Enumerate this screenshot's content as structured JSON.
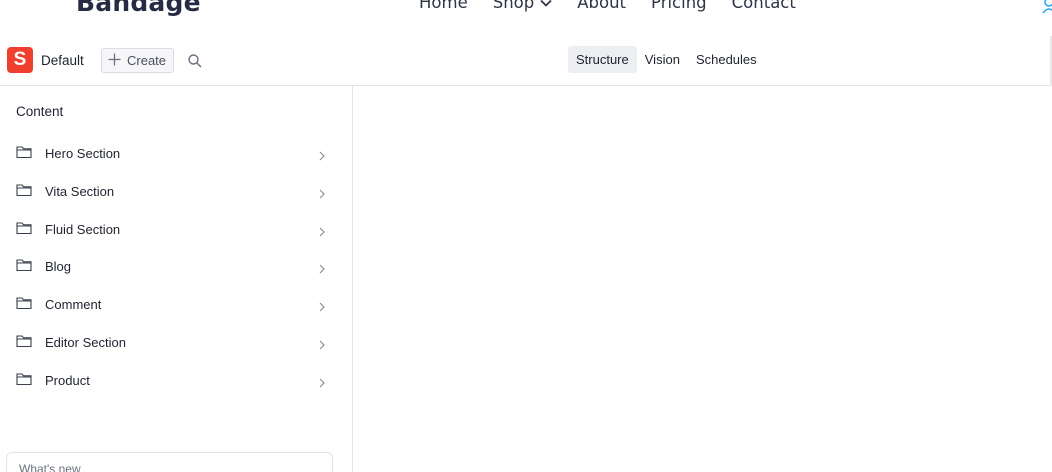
{
  "site": {
    "brand": "Bandage",
    "nav": [
      {
        "label": "Home"
      },
      {
        "label": "Shop"
      },
      {
        "label": "About"
      },
      {
        "label": "Pricing"
      },
      {
        "label": "Contact"
      }
    ]
  },
  "toolbar": {
    "logo_letter": "S",
    "workspace": "Default",
    "create_label": "Create",
    "tabs": [
      {
        "label": "Structure",
        "active": true
      },
      {
        "label": "Vision",
        "active": false
      },
      {
        "label": "Schedules",
        "active": false
      }
    ]
  },
  "content": {
    "title": "Content",
    "items": [
      {
        "label": "Hero Section"
      },
      {
        "label": "Vita Section"
      },
      {
        "label": "Fluid Section"
      },
      {
        "label": "Blog"
      },
      {
        "label": "Comment"
      },
      {
        "label": "Editor Section"
      },
      {
        "label": "Product"
      }
    ],
    "whats_new": "What's new"
  },
  "colors": {
    "accent": "#f03e2f",
    "brand_text": "#252b42",
    "user_icon": "#23a6f0"
  }
}
